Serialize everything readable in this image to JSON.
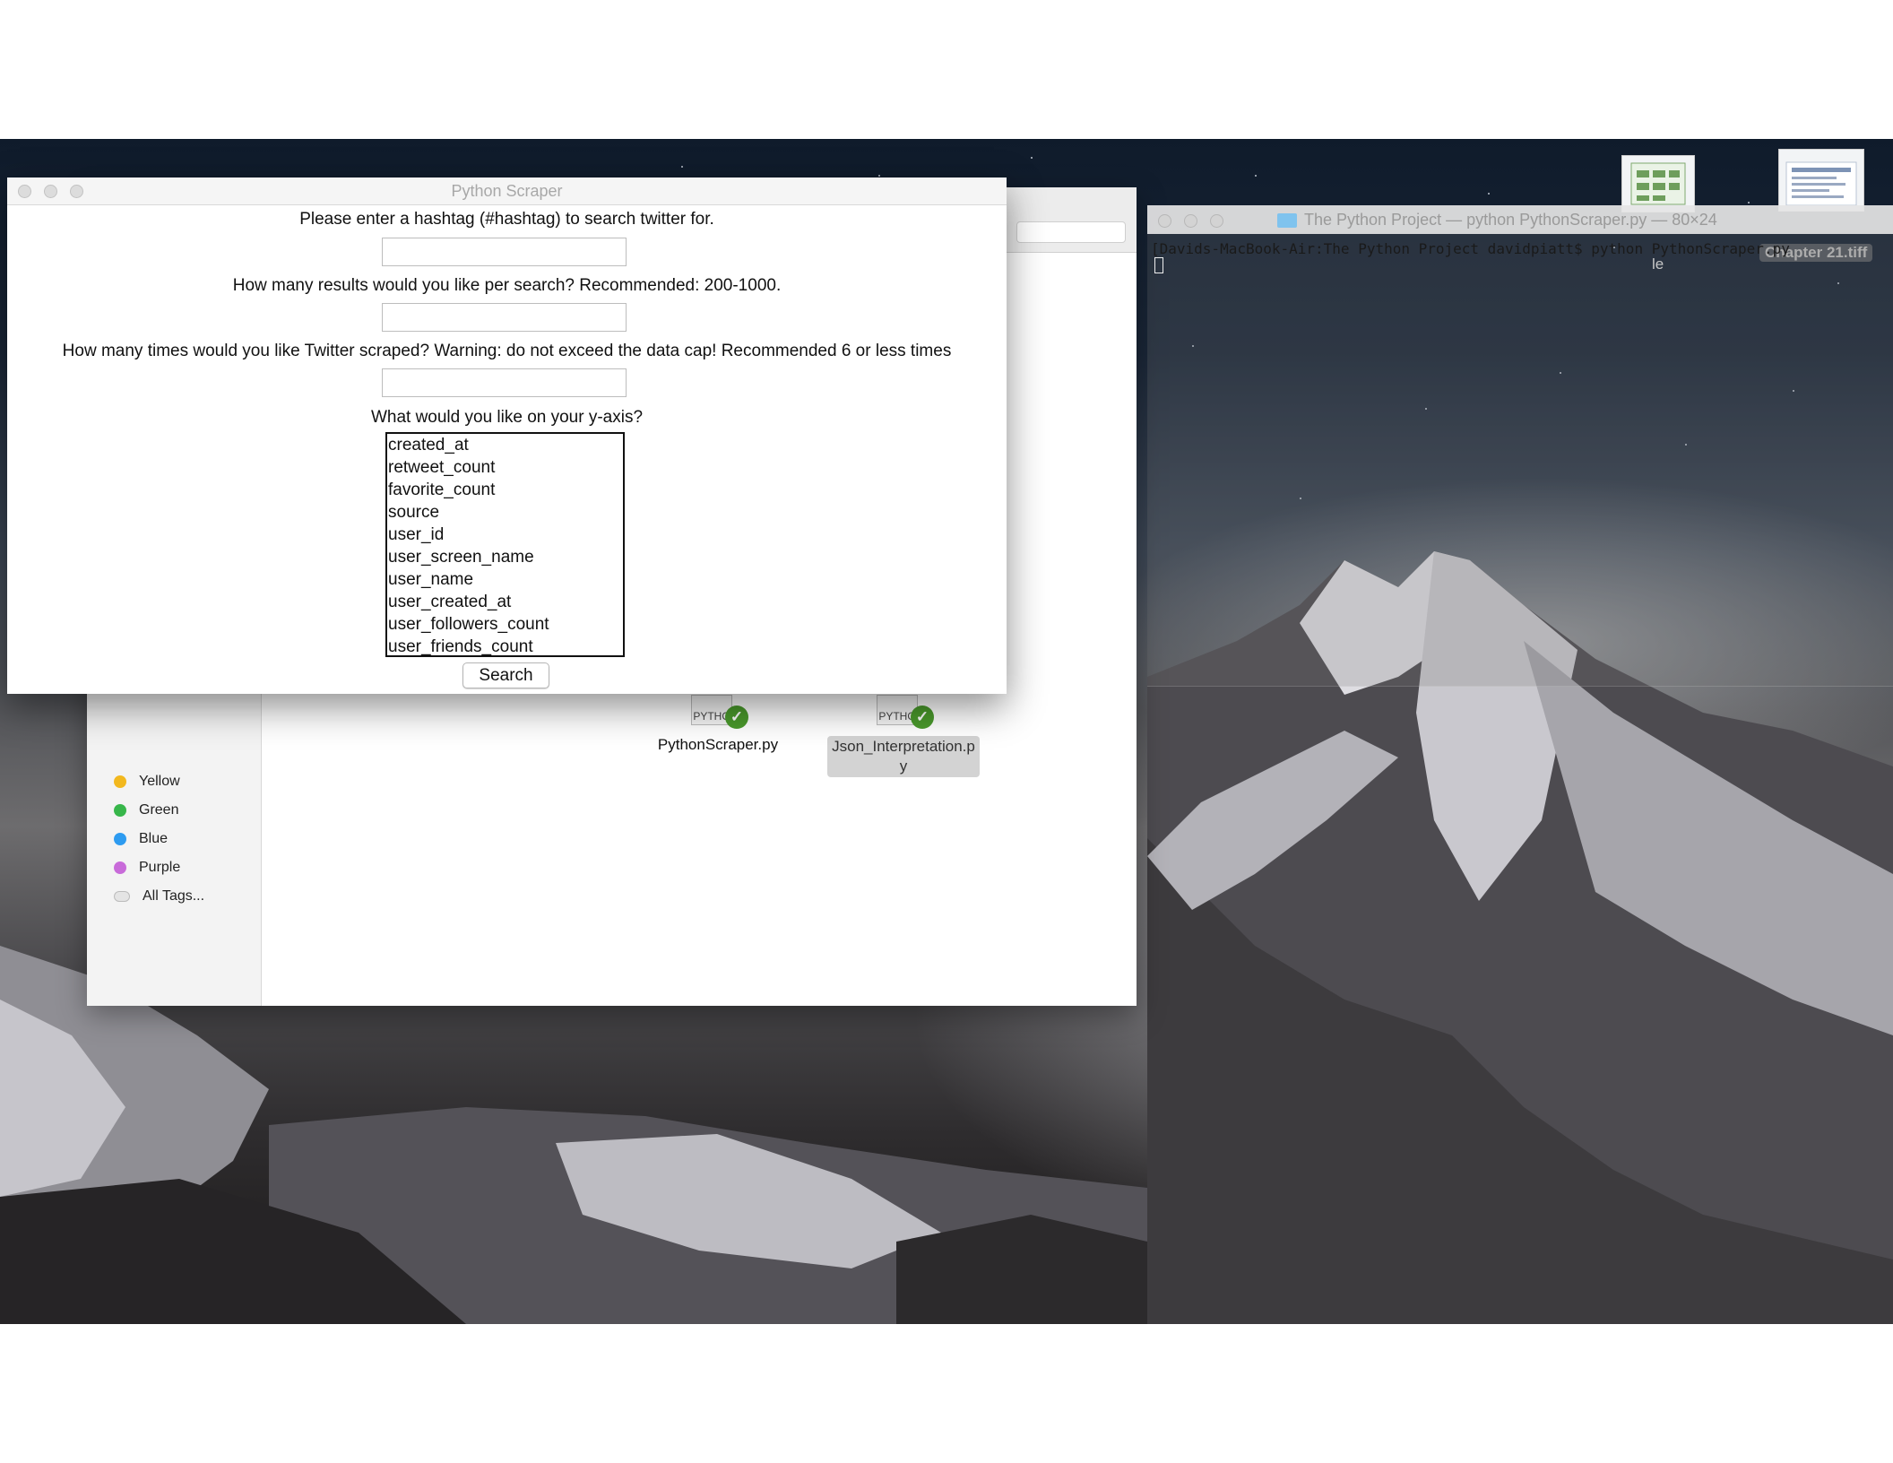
{
  "terminal": {
    "title": "The Python Project — python PythonScraper.py — 80×24",
    "prompt_line": "[Davids-MacBook-Air:The Python Project davidpiatt$ python PythonScraper.py"
  },
  "finder": {
    "tags": [
      {
        "label": "Yellow",
        "color": "#f2b81e"
      },
      {
        "label": "Green",
        "color": "#37b64a"
      },
      {
        "label": "Blue",
        "color": "#2d9bf0"
      },
      {
        "label": "Purple",
        "color": "#c86bd9"
      },
      {
        "label": "All Tags...",
        "color": "#d0d0d0"
      }
    ],
    "files": [
      {
        "icon_label": "PYTHO",
        "name": "PythonScraper.py"
      },
      {
        "icon_label": "PYTHO",
        "name": "Json_Interpretation.py"
      }
    ]
  },
  "desktop": {
    "icon_label_1": "le",
    "icon_label_2": "Chapter 21.tiff"
  },
  "scraper": {
    "title": "Python Scraper",
    "prompt_hashtag": "Please enter a hashtag (#hashtag) to search twitter for.",
    "prompt_results": "How many results would you like per search? Recommended: 200-1000.",
    "prompt_times": "How many times would you like Twitter scraped? Warning: do not exceed the data cap! Recommended 6 or less times",
    "prompt_yaxis": "What would you like on your y-axis?",
    "hashtag_value": "",
    "results_value": "",
    "times_value": "",
    "yaxis_options": [
      "created_at",
      "retweet_count",
      "favorite_count",
      "source",
      "user_id",
      "user_screen_name",
      "user_name",
      "user_created_at",
      "user_followers_count",
      "user_friends_count"
    ],
    "search_label": "Search"
  }
}
